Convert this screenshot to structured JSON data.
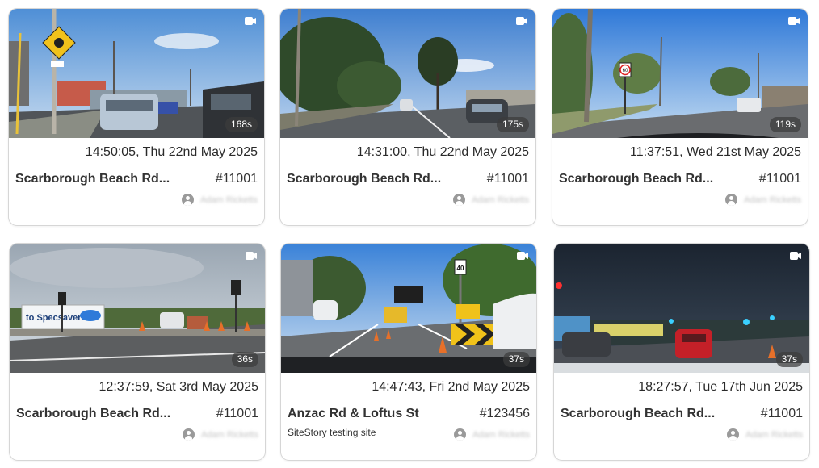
{
  "cards": [
    {
      "duration": "168s",
      "timestamp": "14:50:05, Thu 22nd May 2025",
      "location": "Scarborough Beach Rd...",
      "id": "#11001",
      "site": "",
      "user": "Adam Ricketts",
      "camera_icon": "video-camera-icon",
      "user_icon": "user-circle-icon"
    },
    {
      "duration": "175s",
      "timestamp": "14:31:00, Thu 22nd May 2025",
      "location": "Scarborough Beach Rd...",
      "id": "#11001",
      "site": "",
      "user": "Adam Ricketts",
      "camera_icon": "video-camera-icon",
      "user_icon": "user-circle-icon"
    },
    {
      "duration": "119s",
      "timestamp": "11:37:51, Wed 21st May 2025",
      "location": "Scarborough Beach Rd...",
      "id": "#11001",
      "site": "",
      "user": "Adam Ricketts",
      "camera_icon": "video-camera-icon",
      "user_icon": "user-circle-icon"
    },
    {
      "duration": "36s",
      "timestamp": "12:37:59, Sat 3rd May 2025",
      "location": "Scarborough Beach Rd...",
      "id": "#11001",
      "site": "",
      "user": "Adam Ricketts",
      "camera_icon": "video-camera-icon",
      "user_icon": "user-circle-icon"
    },
    {
      "duration": "37s",
      "timestamp": "14:47:43, Fri 2nd May 2025",
      "location": "Anzac Rd & Loftus St",
      "id": "#123456",
      "site": "SiteStory testing site",
      "user": "Adam Ricketts",
      "camera_icon": "video-camera-icon",
      "user_icon": "user-circle-icon"
    },
    {
      "duration": "37s",
      "timestamp": "18:27:57, Tue 17th Jun 2025",
      "location": "Scarborough Beach Rd...",
      "id": "#11001",
      "site": "",
      "user": "Adam Ricketts",
      "camera_icon": "video-camera-icon",
      "user_icon": "user-circle-icon"
    }
  ],
  "thumbnail_signs": {
    "card3_speed": "60",
    "card4_billboard": "to Specsavers",
    "card5_speed": "40"
  }
}
